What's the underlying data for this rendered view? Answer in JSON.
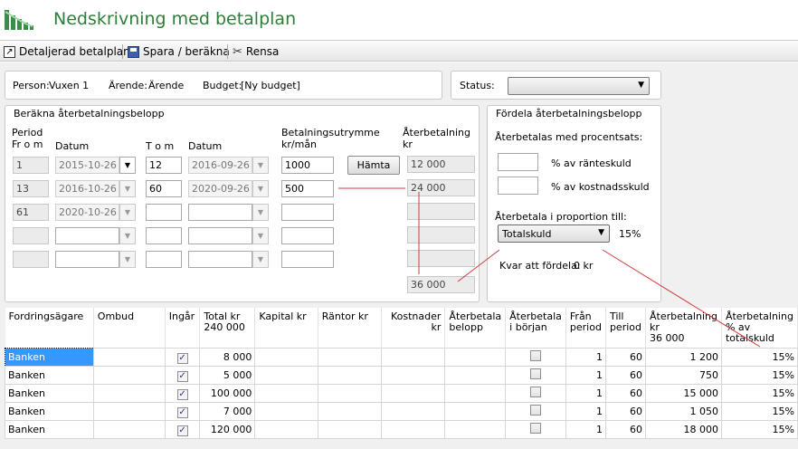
{
  "app": {
    "title": "Nedskrivning med betalplan",
    "logo_icon": "bar-chart-logo-icon"
  },
  "toolbar": {
    "detail_label": "Detaljerad betalplan",
    "save_label": "Spara / beräkna",
    "clear_label": "Rensa"
  },
  "info": {
    "person_label": "Person:",
    "person_value": "Vuxen 1",
    "case_label": "Ärende:",
    "case_value": "Ärende",
    "budget_label": "Budget:",
    "budget_value": "[Ny budget]",
    "status_label": "Status:",
    "status_value": ""
  },
  "calc": {
    "title": "Beräkna återbetalningsbelopp",
    "col_period_from": "Period Fr o m",
    "col_date": "Datum",
    "col_to": "T o m",
    "col_date2": "Datum",
    "col_capacity": "Betalningsutrymme kr/mån",
    "col_repayment": "Återbetalning kr",
    "fetch_button": "Hämta",
    "rows": [
      {
        "from": "1",
        "date_from": "2015-10-26",
        "to": "12",
        "date_to": "2016-09-26",
        "capacity": "1000",
        "repay": "12 000"
      },
      {
        "from": "13",
        "date_from": "2016-10-26",
        "to": "60",
        "date_to": "2020-09-26",
        "capacity": "500",
        "repay": "24 000"
      },
      {
        "from": "61",
        "date_from": "2020-10-26",
        "to": "",
        "date_to": "",
        "capacity": "",
        "repay": ""
      },
      {
        "from": "",
        "date_from": "",
        "to": "",
        "date_to": "",
        "capacity": "",
        "repay": ""
      },
      {
        "from": "",
        "date_from": "",
        "to": "",
        "date_to": "",
        "capacity": "",
        "repay": ""
      }
    ],
    "total": "36 000"
  },
  "distribute": {
    "title": "Fördela återbetalningsbelopp",
    "percent_heading": "Återbetalas med procentsats:",
    "interest_label": "% av ränteskuld",
    "cost_label": "% av kostnadsskuld",
    "proportion_label": "Återbetala i proportion till:",
    "proportion_value": "Totalskuld",
    "proportion_percent": "15%",
    "remaining_label": "Kvar att fördela:",
    "remaining_value": "0 kr"
  },
  "grid": {
    "headers": {
      "creditor": "Fordringsägare",
      "agent": "Ombud",
      "included": "Ingår",
      "total": "Total kr",
      "total_sum": "240 000",
      "capital": "Kapital kr",
      "interest": "Räntor kr",
      "costs": "Kostnader kr",
      "repay_amount": "Återbetala belopp",
      "repay_start": "Återbetala i början",
      "from_period": "Från period",
      "to_period": "Till period",
      "repay_kr": "Återbetalning kr",
      "repay_kr_sum": "36 000",
      "repay_pct": "Återbetalning % av totalskuld"
    },
    "rows": [
      {
        "creditor": "Banken",
        "agent": "",
        "included": true,
        "total": "8 000",
        "capital": "",
        "interest": "",
        "costs": "",
        "repay_amount": "",
        "repay_start": false,
        "from": "1",
        "to": "60",
        "repay_kr": "1 200",
        "repay_pct": "15%"
      },
      {
        "creditor": "Banken",
        "agent": "",
        "included": true,
        "total": "5 000",
        "capital": "",
        "interest": "",
        "costs": "",
        "repay_amount": "",
        "repay_start": false,
        "from": "1",
        "to": "60",
        "repay_kr": "750",
        "repay_pct": "15%"
      },
      {
        "creditor": "Banken",
        "agent": "",
        "included": true,
        "total": "100 000",
        "capital": "",
        "interest": "",
        "costs": "",
        "repay_amount": "",
        "repay_start": false,
        "from": "1",
        "to": "60",
        "repay_kr": "15 000",
        "repay_pct": "15%"
      },
      {
        "creditor": "Banken",
        "agent": "",
        "included": true,
        "total": "7 000",
        "capital": "",
        "interest": "",
        "costs": "",
        "repay_amount": "",
        "repay_start": false,
        "from": "1",
        "to": "60",
        "repay_kr": "1 050",
        "repay_pct": "15%"
      },
      {
        "creditor": "Banken",
        "agent": "",
        "included": true,
        "total": "120 000",
        "capital": "",
        "interest": "",
        "costs": "",
        "repay_amount": "",
        "repay_start": false,
        "from": "1",
        "to": "60",
        "repay_kr": "18 000",
        "repay_pct": "15%"
      }
    ]
  },
  "colors": {
    "title": "#2f7d3a",
    "selection": "#3399ff",
    "annotation_line": "#d23b3b"
  }
}
